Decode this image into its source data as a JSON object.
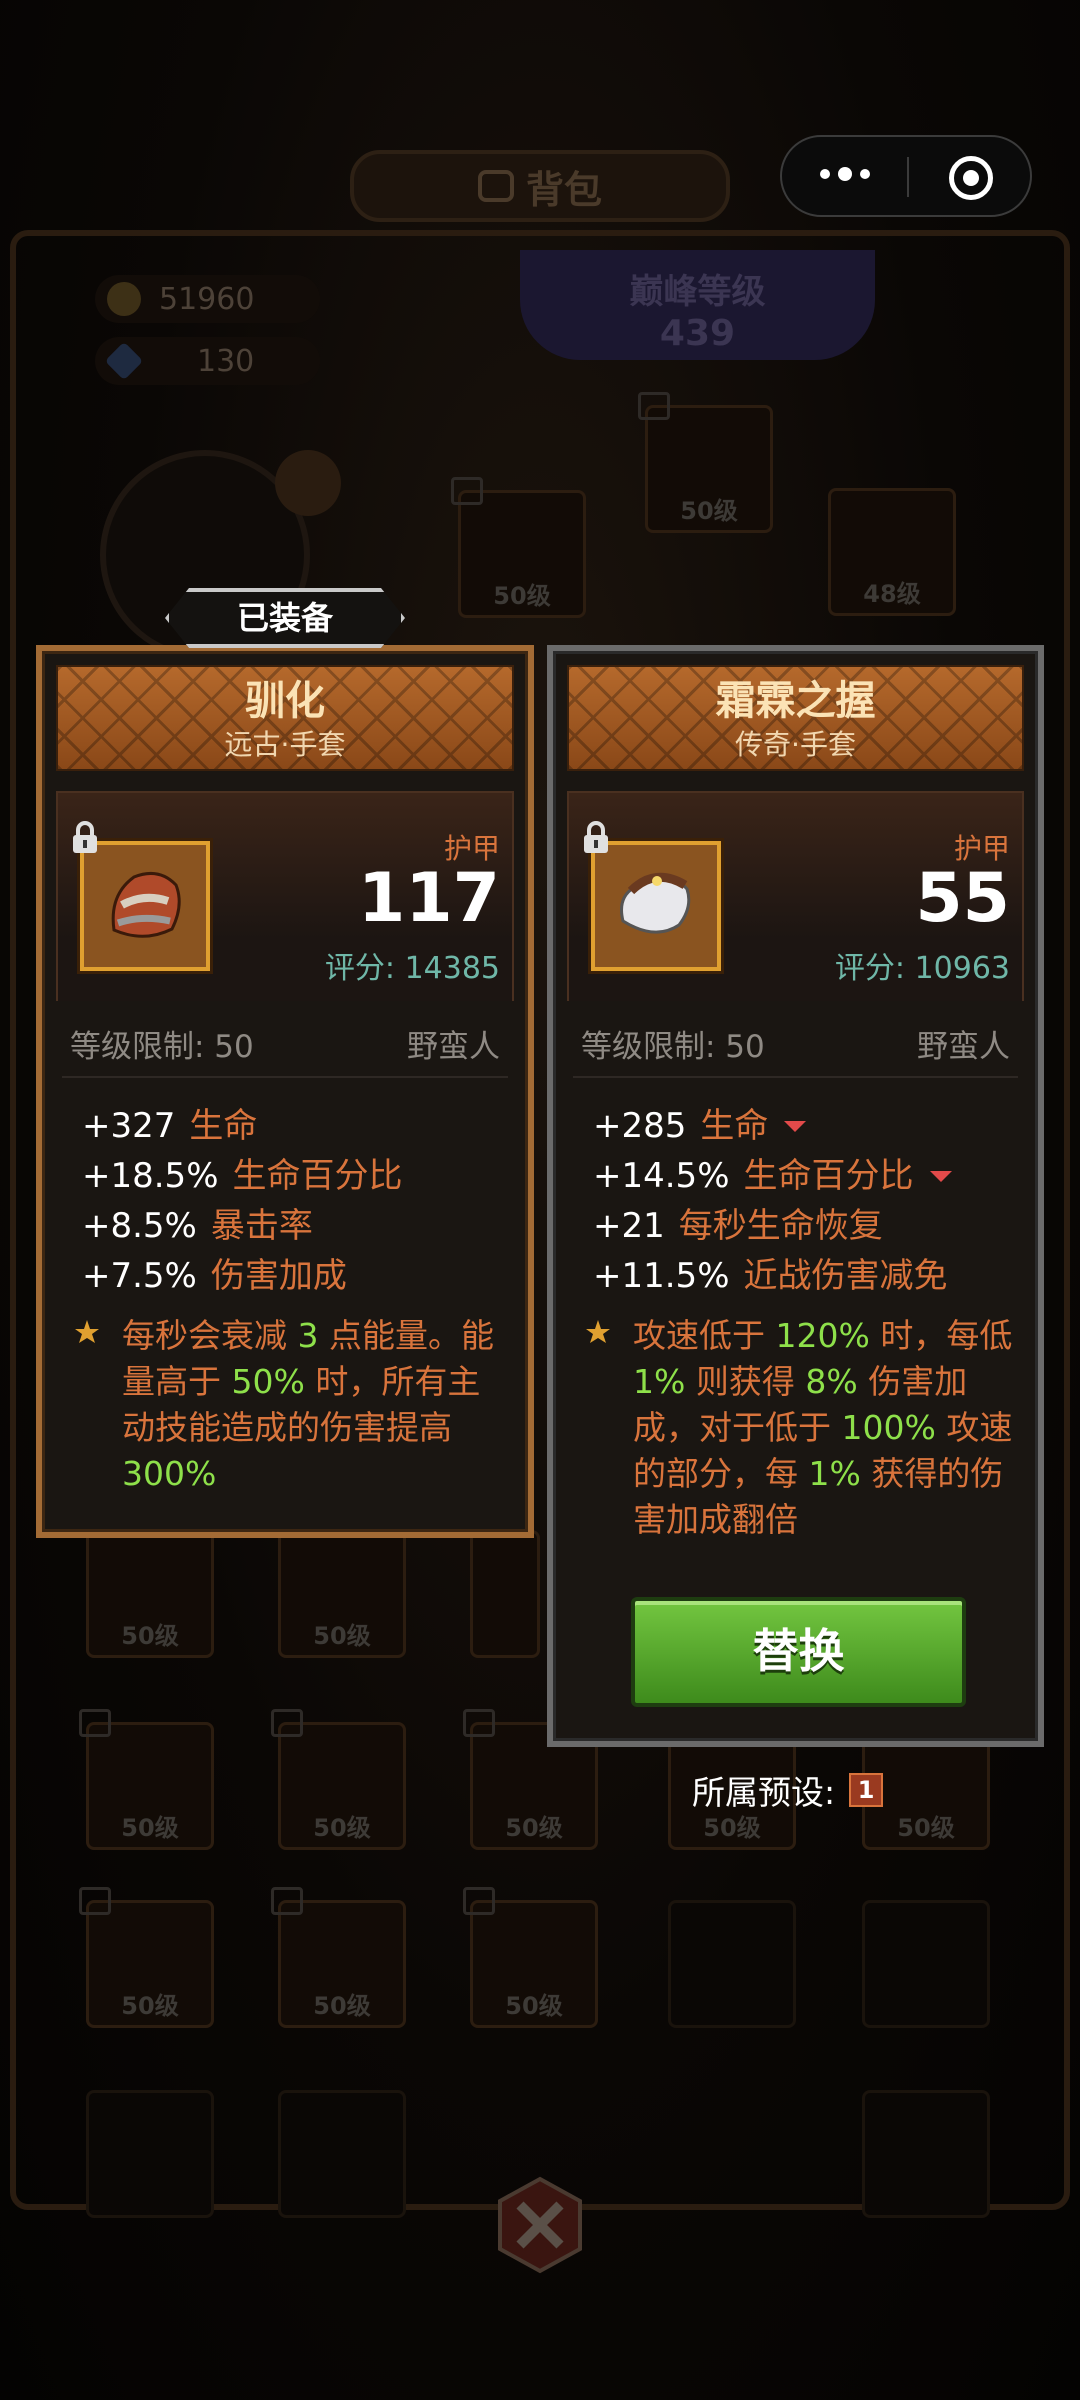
{
  "bag": {
    "title": "背包",
    "gold": "51960",
    "gems": "130",
    "peak_label": "巅峰等级",
    "peak_value": "439",
    "slot_level": "50级",
    "slot_level_alt": "48级"
  },
  "equipped_tag": "已装备",
  "left_card": {
    "name": "驯化",
    "subtitle": "远古·手套",
    "armor_label": "护甲",
    "armor_value": "117",
    "score": "评分: 14385",
    "level_req": "等级限制: 50",
    "class": "野蛮人",
    "stats": [
      {
        "value": "+327",
        "name": "生命"
      },
      {
        "value": "+18.5%",
        "name": "生命百分比"
      },
      {
        "value": "+8.5%",
        "name": "暴击率"
      },
      {
        "value": "+7.5%",
        "name": "伤害加成"
      }
    ],
    "passive": {
      "p1": "每秒会衰减",
      "h1": "3",
      "p2": "点能量。能量高于",
      "h2": "50%",
      "p3": "时，所有主动技能造成的伤害提高",
      "h3": "300%"
    }
  },
  "right_card": {
    "name": "霜霖之握",
    "subtitle": "传奇·手套",
    "armor_label": "护甲",
    "armor_value": "55",
    "score": "评分: 10963",
    "level_req": "等级限制: 50",
    "class": "野蛮人",
    "stats": [
      {
        "value": "+285",
        "name": "生命",
        "down": true
      },
      {
        "value": "+14.5%",
        "name": "生命百分比",
        "down": true
      },
      {
        "value": "+21",
        "name": "每秒生命恢复"
      },
      {
        "value": "+11.5%",
        "name": "近战伤害减免"
      }
    ],
    "passive": {
      "p1": "攻速低于",
      "h1": "120%",
      "p2": "时，每低",
      "h2": "1%",
      "p3": "则获得",
      "h3": "8%",
      "p4": "伤害加成，对于低于",
      "h4": "100%",
      "p5": "攻速的部分，每",
      "h5": "1%",
      "p6": "获得的伤害加成翻倍"
    },
    "replace_label": "替换"
  },
  "preset": {
    "label": "所属预设:",
    "value": "1"
  },
  "colors": {
    "stat_name": "#d9743c",
    "highlight": "#8ee04a",
    "score": "#6fb7a8",
    "down_arrow": "#e24a4a"
  }
}
